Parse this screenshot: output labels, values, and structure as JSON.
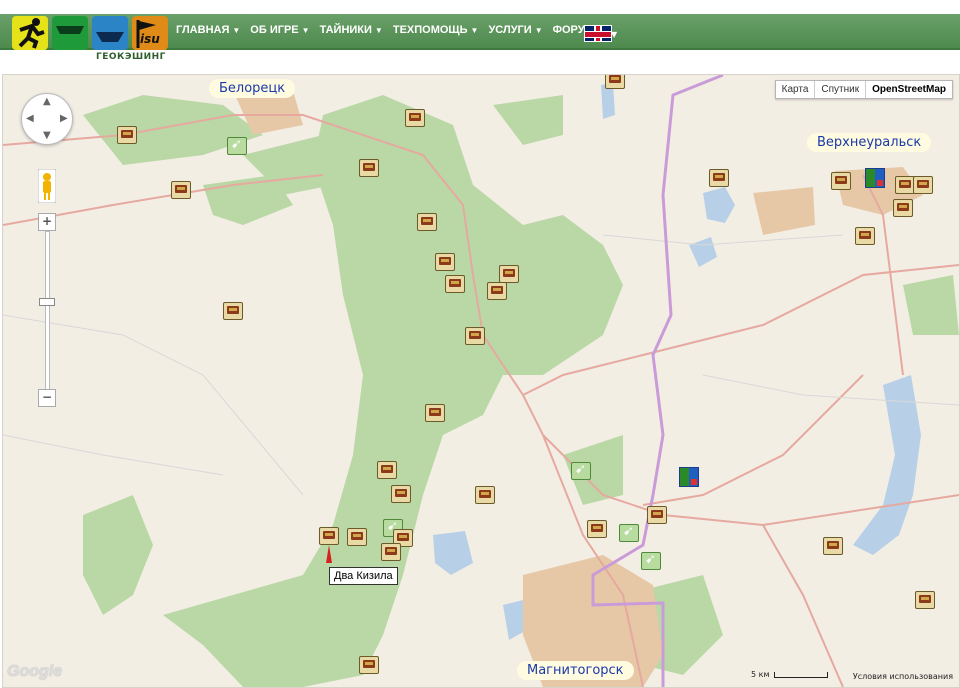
{
  "header": {
    "logo_caption": "ГЕОКЭШИНГ",
    "logo_badge": "isu",
    "menu": [
      {
        "label": "ГЛАВНАЯ",
        "caret": "▼"
      },
      {
        "label": "ОБ ИГРЕ",
        "caret": "▼"
      },
      {
        "label": "ТАЙНИКИ",
        "caret": "▼"
      },
      {
        "label": "ТЕХПОМОЩЬ",
        "caret": "▼"
      },
      {
        "label": "УСЛУГИ",
        "caret": "▼"
      },
      {
        "label": "ФОРУМ",
        "caret": ""
      }
    ],
    "language_icon": "uk-flag-icon"
  },
  "map": {
    "map_type": {
      "options": [
        "Карта",
        "Спутник",
        "OpenStreetMap"
      ],
      "active": "OpenStreetMap"
    },
    "cities": [
      {
        "name": "Белорецк"
      },
      {
        "name": "Верхнеуральск"
      },
      {
        "name": "Магнитогорск"
      }
    ],
    "tooltip": "Два Кизила",
    "scale_label": "5 км",
    "terms_label": "Условия использования",
    "google_label": "Google",
    "zoom_in": "+",
    "zoom_out": "−",
    "colors": {
      "forest": "#b9d8a6",
      "water": "#b7d0e8",
      "urban": "#e6c8a6",
      "border": "#c99bd8",
      "road": "#e6a9a0"
    }
  }
}
